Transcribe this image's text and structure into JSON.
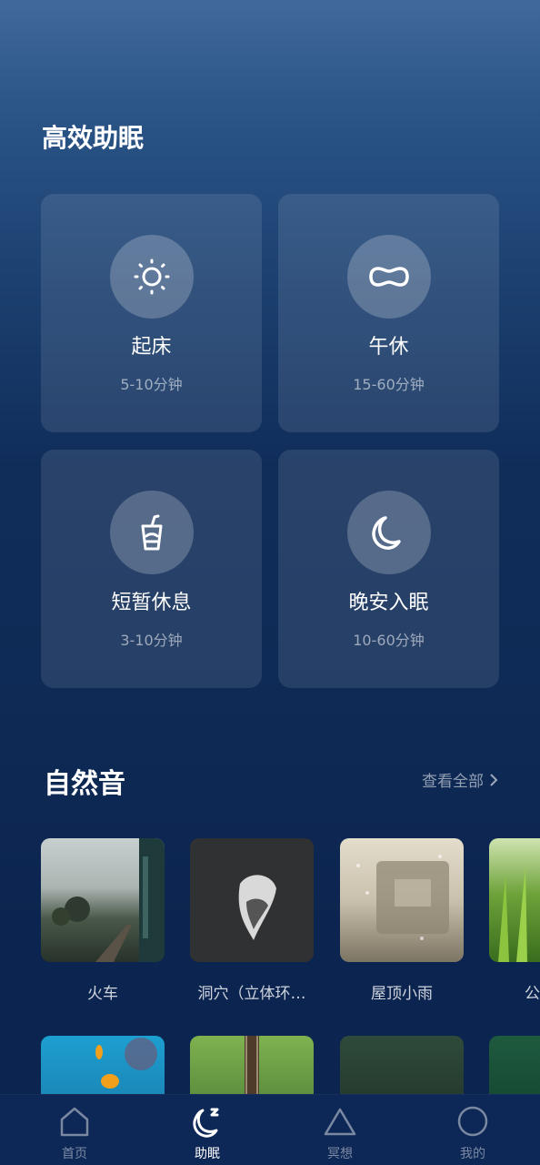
{
  "efficient_sleep": {
    "title": "高效助眠",
    "cards": [
      {
        "title": "起床",
        "subtitle": "5-10分钟",
        "icon": "sun-icon"
      },
      {
        "title": "午休",
        "subtitle": "15-60分钟",
        "icon": "pillow-icon"
      },
      {
        "title": "短暂休息",
        "subtitle": "3-10分钟",
        "icon": "cup-icon"
      },
      {
        "title": "晚安入眠",
        "subtitle": "10-60分钟",
        "icon": "moon-icon"
      }
    ]
  },
  "nature_sounds": {
    "title": "自然音",
    "see_all": "查看全部",
    "items": [
      {
        "label": "火车"
      },
      {
        "label": "洞穴（立体环…"
      },
      {
        "label": "屋顶小雨"
      },
      {
        "label": "公"
      }
    ]
  },
  "tabbar": {
    "items": [
      {
        "label": "首页",
        "icon": "home-icon"
      },
      {
        "label": "助眠",
        "icon": "moon-zz-icon"
      },
      {
        "label": "冥想",
        "icon": "triangle-icon"
      },
      {
        "label": "我的",
        "icon": "circle-icon"
      }
    ],
    "active": "助眠"
  }
}
